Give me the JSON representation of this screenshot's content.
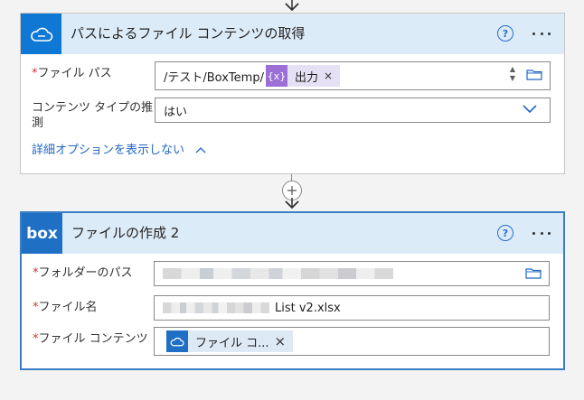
{
  "card1": {
    "title": "パスによるファイル コンテンツの取得",
    "help": "?",
    "fields": {
      "file_path": {
        "required_mark": "*",
        "label": "ファイル パス",
        "prefix": "/テスト/BoxTemp/",
        "token_icon": "{x}",
        "token_label": "出力",
        "token_close": "×"
      },
      "content_type": {
        "label_line1": "コンテンツ タイプの推",
        "label_line2": "測",
        "value": "はい"
      }
    },
    "advanced_link": "詳細オプションを表示しない"
  },
  "card2": {
    "title": "ファイルの作成 2",
    "logo_text": "box",
    "help": "?",
    "fields": {
      "folder_path": {
        "required_mark": "*",
        "label": "フォルダーのパス"
      },
      "file_name": {
        "required_mark": "*",
        "label": "ファイル名",
        "value_suffix": "List v2.xlsx"
      },
      "file_content": {
        "required_mark": "*",
        "label": "ファイル コンテンツ",
        "token_label": "ファイル コ...",
        "token_close": "×"
      }
    }
  },
  "colors": {
    "header_bg": "#dcebf8",
    "accent_blue": "#2266c5",
    "box_blue": "#1f6fc5",
    "onedrive_blue": "#0f78d4",
    "token_purple": "#9b6fd6",
    "required_red": "#d13438"
  },
  "icons": {
    "card1": "onedrive-cloud-icon",
    "card2": "box-logo-icon",
    "folder": "folder-icon",
    "dropdown": "chevron-down-icon",
    "expand": "chevron-up-icon",
    "add_step": "plus-icon",
    "more": "more-options-icon",
    "help": "help-icon"
  }
}
